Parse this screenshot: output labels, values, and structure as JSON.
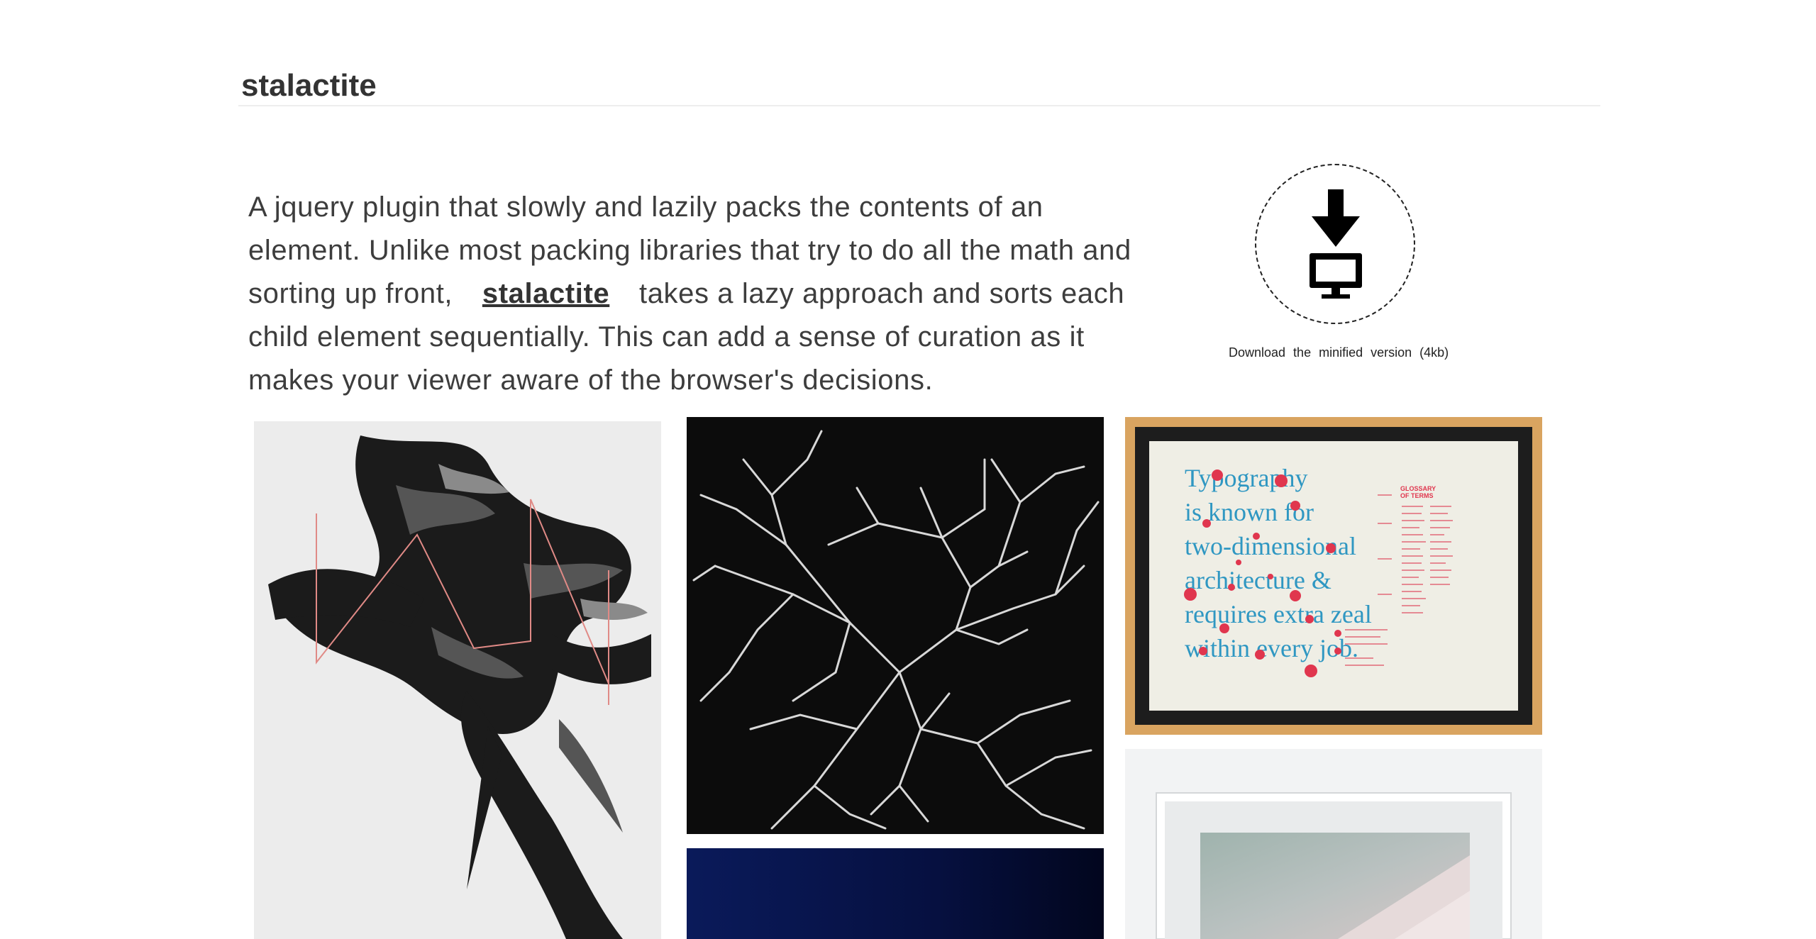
{
  "header": {
    "title": "stalactite"
  },
  "intro": {
    "before": "A jquery plugin that slowly and lazily packs the contents of an element. Unlike most packing libraries that try to do all the math and sorting up front, ",
    "link": "stalactite",
    "after": " takes a lazy approach and sorts each child element sequentially. This can add a sense of curation as it makes your viewer aware of the browser's decisions."
  },
  "download": {
    "icon": "download-to-computer-icon",
    "caption": "Download the minified version (4kb)"
  },
  "gallery": {
    "poster_typography": {
      "lines": [
        "Typography",
        "is known for",
        "two-dimensional",
        "architecture &",
        "requires extra zeal",
        "within every job."
      ],
      "glossary_title_1": "GLOSSARY",
      "glossary_title_2": "OF TERMS"
    }
  }
}
